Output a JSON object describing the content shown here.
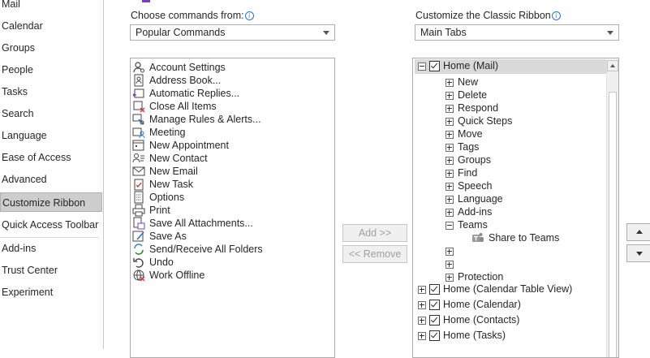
{
  "nav": {
    "items": [
      {
        "label": "Mail"
      },
      {
        "label": "Calendar"
      },
      {
        "label": "Groups"
      },
      {
        "label": "People"
      },
      {
        "label": "Tasks"
      },
      {
        "label": "Search"
      },
      {
        "label": "Language"
      },
      {
        "label": "Ease of Access"
      },
      {
        "label": "Advanced"
      },
      {
        "label": "Customize Ribbon",
        "selected": true
      },
      {
        "label": "Quick Access Toolbar"
      },
      {
        "label": "Add-ins"
      },
      {
        "label": "Trust Center"
      },
      {
        "label": "Experiment"
      }
    ]
  },
  "left_panel": {
    "label": "Choose commands from:",
    "dropdown_value": "Popular Commands",
    "commands": [
      {
        "label": "Account Settings",
        "icon": "account-settings-icon"
      },
      {
        "label": "Address Book...",
        "icon": "address-book-icon"
      },
      {
        "label": "Automatic Replies...",
        "icon": "automatic-replies-icon"
      },
      {
        "label": "Close All Items",
        "icon": "close-all-items-icon"
      },
      {
        "label": "Manage Rules & Alerts...",
        "icon": "rules-icon"
      },
      {
        "label": "Meeting",
        "icon": "meeting-icon"
      },
      {
        "label": "New Appointment",
        "icon": "appointment-icon"
      },
      {
        "label": "New Contact",
        "icon": "contact-icon"
      },
      {
        "label": "New Email",
        "icon": "email-icon"
      },
      {
        "label": "New Task",
        "icon": "task-icon"
      },
      {
        "label": "Options",
        "icon": "options-icon"
      },
      {
        "label": "Print",
        "icon": "print-icon"
      },
      {
        "label": "Save All Attachments...",
        "icon": "save-attachments-icon"
      },
      {
        "label": "Save As",
        "icon": "save-as-icon"
      },
      {
        "label": "Send/Receive All Folders",
        "icon": "send-receive-icon"
      },
      {
        "label": "Undo",
        "icon": "undo-icon"
      },
      {
        "label": "Work Offline",
        "icon": "work-offline-icon"
      }
    ]
  },
  "buttons": {
    "add": "Add >>",
    "remove": "<< Remove"
  },
  "right_panel": {
    "label": "Customize the Classic Ribbon",
    "dropdown_value": "Main Tabs",
    "tree": {
      "root": "Home (Mail)",
      "groups": [
        "New",
        "Delete",
        "Respond",
        "Quick Steps",
        "Move",
        "Tags",
        "Groups",
        "Find",
        "Speech",
        "Language",
        "Add-ins"
      ],
      "teams": "Teams",
      "teams_child": "Share to Teams",
      "protection": "Protection",
      "other_tabs": [
        "Home (Calendar Table View)",
        "Home (Calendar)",
        "Home (Contacts)",
        "Home (Tasks)"
      ]
    }
  },
  "colors": {
    "selected_nav": "#cdcdcd",
    "info_blue": "#2b74c7",
    "teams_purple": "#5b5fc7",
    "accent_purple": "#7b3fc4"
  }
}
